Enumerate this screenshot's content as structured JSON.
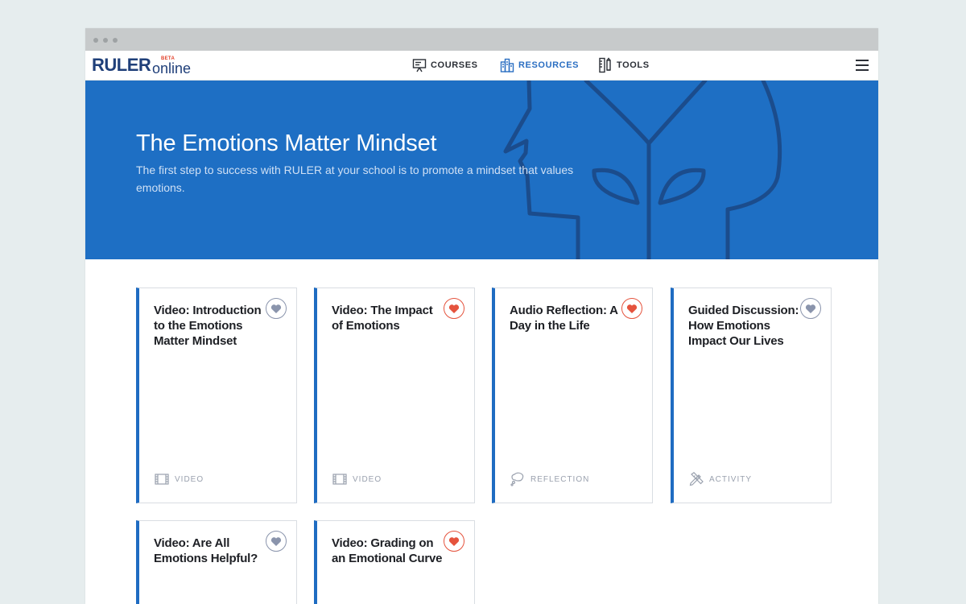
{
  "app": {
    "logo_main": "RULER",
    "logo_sub": "online",
    "logo_badge": "BETA"
  },
  "nav": {
    "items": [
      {
        "label": "COURSES",
        "icon": "presentation-board-icon",
        "active": false
      },
      {
        "label": "RESOURCES",
        "icon": "resources-building-icon",
        "active": true
      },
      {
        "label": "TOOLS",
        "icon": "tools-icon",
        "active": false
      }
    ],
    "menu_icon": "hamburger-menu-icon"
  },
  "hero": {
    "title": "The Emotions Matter Mindset",
    "subtitle": "The first step to success with RULER at your school is to promote a mindset that values emotions.",
    "art": "head-with-sprouting-plant-illustration"
  },
  "cards": [
    {
      "title": "Video: Introduction to the Emotions Matter Mindset",
      "type": "VIDEO",
      "type_icon": "film-icon",
      "favorited": false
    },
    {
      "title": "Video: The Impact of Emotions",
      "type": "VIDEO",
      "type_icon": "film-icon",
      "favorited": true
    },
    {
      "title": "Audio Reflection: A Day in the Life",
      "type": "REFLECTION",
      "type_icon": "thought-bubble-icon",
      "favorited": true
    },
    {
      "title": "Guided Discussion: How Emotions Impact Our Lives",
      "type": "ACTIVITY",
      "type_icon": "pencil-ruler-icon",
      "favorited": false
    },
    {
      "title": "Video: Are All Emotions Helpful?",
      "type": "",
      "type_icon": "",
      "favorited": false
    },
    {
      "title": "Video: Grading on an Emotional Curve",
      "type": "",
      "type_icon": "",
      "favorited": true
    }
  ],
  "colors": {
    "brand_navy": "#1f3f79",
    "hero_blue": "#1e6fc4",
    "accent_blue": "#2a6ec2",
    "favorite_red": "#e5533d",
    "favorite_off": "#8a94ac"
  }
}
